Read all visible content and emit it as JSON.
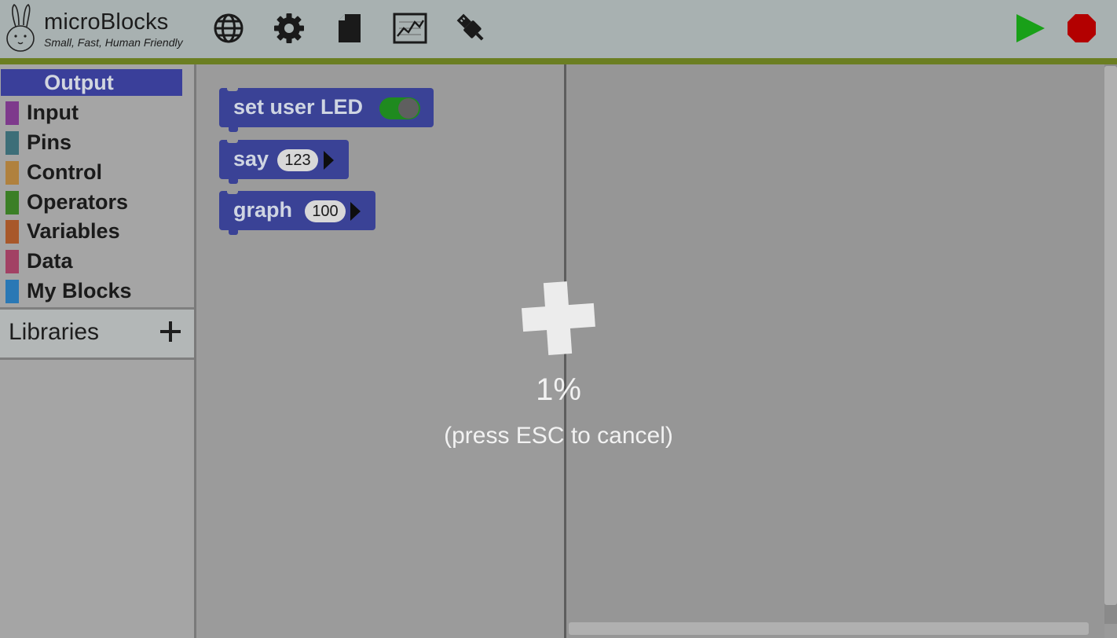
{
  "app": {
    "title": "microBlocks",
    "subtitle": "Small, Fast, Human Friendly"
  },
  "toolbar": {
    "icons": [
      "globe-icon",
      "gear-icon",
      "file-icon",
      "graph-icon",
      "usb-icon"
    ],
    "run_icon": "play-icon",
    "stop_icon": "stop-icon",
    "run_color": "#19a018",
    "stop_color": "#b30000"
  },
  "categories": [
    {
      "label": "Output",
      "color": "#3a3f9a",
      "selected": true
    },
    {
      "label": "Input",
      "color": "#7e3a8c"
    },
    {
      "label": "Pins",
      "color": "#3d6e78"
    },
    {
      "label": "Control",
      "color": "#b0813e"
    },
    {
      "label": "Operators",
      "color": "#3b7f26"
    },
    {
      "label": "Variables",
      "color": "#a8582a"
    },
    {
      "label": "Data",
      "color": "#a24164"
    },
    {
      "label": "My Blocks",
      "color": "#2a78b5"
    }
  ],
  "libraries": {
    "label": "Libraries",
    "add_icon": "plus-icon"
  },
  "palette": {
    "blocks": [
      {
        "label": "set user LED",
        "toggle_on": true
      },
      {
        "label": "say",
        "arg": "123"
      },
      {
        "label": "graph",
        "arg": "100"
      }
    ]
  },
  "overlay": {
    "progress_percent": 1,
    "progress_text": "1%",
    "hint": "(press ESC to cancel)",
    "icon": "plus-icon"
  }
}
